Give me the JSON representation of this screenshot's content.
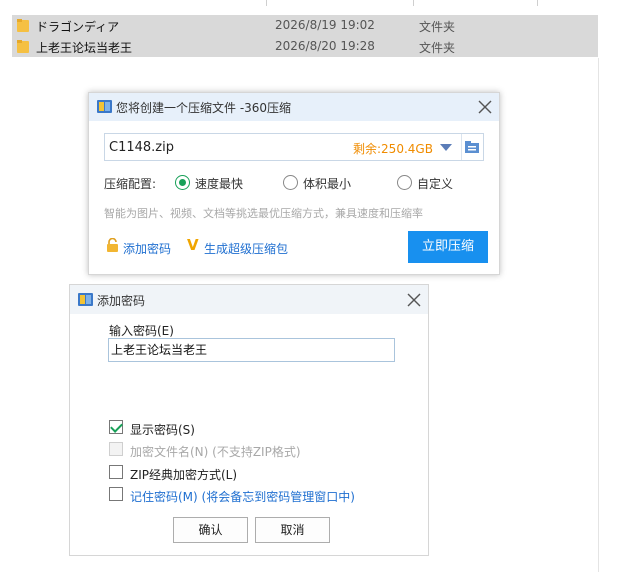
{
  "explorer": {
    "rows": [
      {
        "name": "ドラゴンディア",
        "date": "2026/8/19 19:02",
        "type": "文件夹"
      },
      {
        "name": "上老王论坛当老王",
        "date": "2026/8/20 19:28",
        "type": "文件夹"
      }
    ]
  },
  "compress_dialog": {
    "title": "您将创建一个压缩文件 -360压缩",
    "filename": "C1148.zip",
    "free_space": "剩余:250.4GB",
    "config_label": "压缩配置:",
    "options": [
      "速度最快",
      "体积最小",
      "自定义"
    ],
    "selected_option": "速度最快",
    "hint": "智能为图片、视频、文档等挑选最优压缩方式，兼具速度和压缩率",
    "add_password": "添加密码",
    "make_super": "生成超级压缩包",
    "compress_now": "立即压缩",
    "accent": "#1890ef"
  },
  "password_dialog": {
    "title": "添加密码",
    "input_label": "输入密码(E)",
    "password_value": "上老王论坛当老王",
    "show_password": "显示密码(S)",
    "encrypt_filenames": "加密文件名(N) (不支持ZIP格式)",
    "zip_classic": "ZIP经典加密方式(L)",
    "remember": "记住密码(M) (将会备忘到密码管理窗口中)",
    "ok": "确认",
    "cancel": "取消",
    "show_password_checked": true
  }
}
